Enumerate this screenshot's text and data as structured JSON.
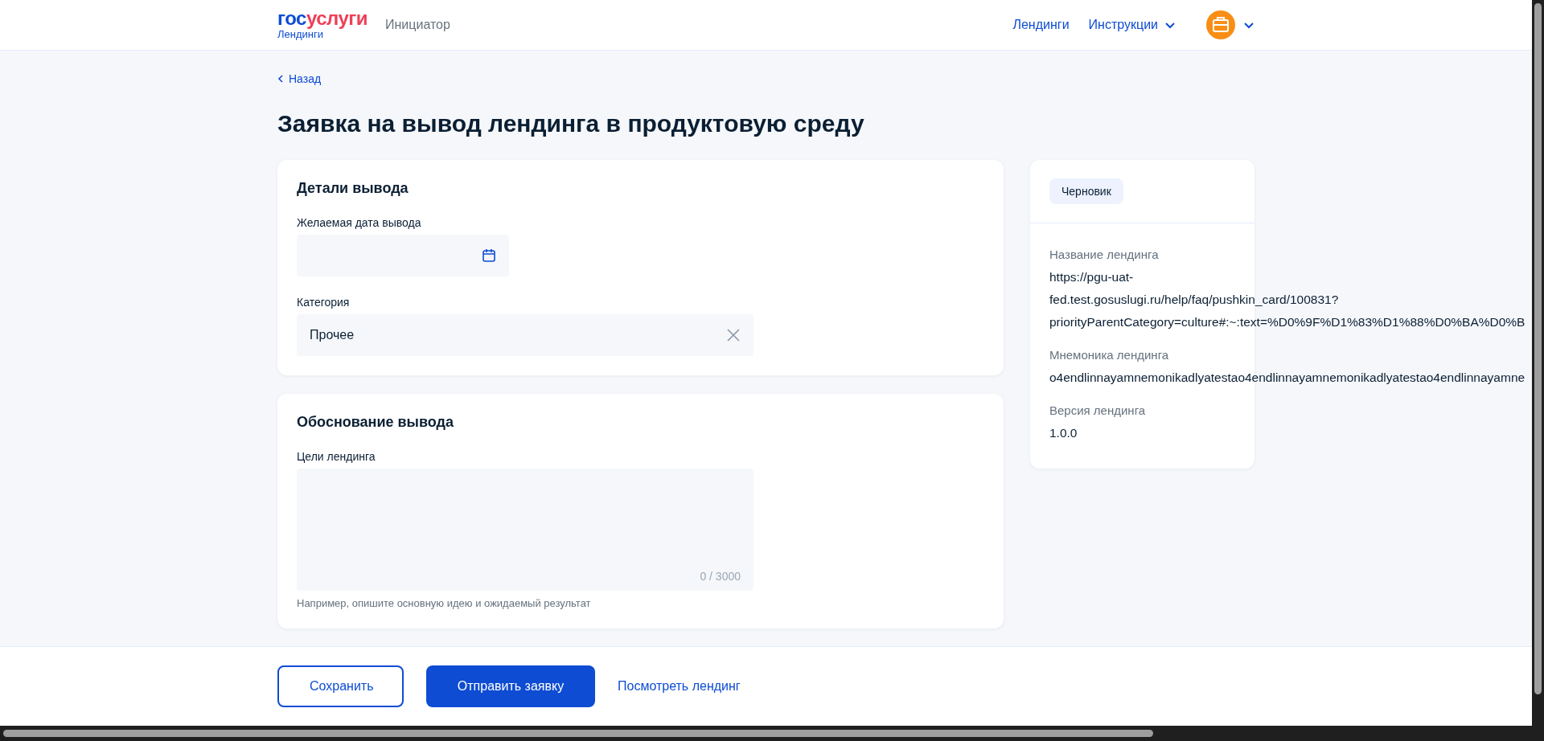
{
  "header": {
    "logo": [
      {
        "text": "гос",
        "color": "#0d4cd3"
      },
      {
        "text": "услуги",
        "color": "#ee3f58"
      }
    ],
    "logo_sub": "Лендинги",
    "role": "Инициатор",
    "nav": [
      {
        "label": "Лендинги",
        "dropdown": false
      },
      {
        "label": "Инструкции",
        "dropdown": true
      }
    ]
  },
  "back_link": "Назад",
  "title": "Заявка на вывод лендинга в продуктовую среду",
  "sections": [
    {
      "title": "Детали вывода",
      "fields": [
        {
          "kind": "date",
          "label": "Желаемая дата вывода"
        },
        {
          "kind": "select",
          "label": "Категория",
          "value": "Прочее"
        }
      ]
    },
    {
      "title": "Обоснование вывода",
      "fields": [
        {
          "kind": "textarea",
          "label": "Цели лендинга",
          "counter": "0 / 3000",
          "hint": "Например, опишите основную идею и ожидаемый результат"
        }
      ]
    }
  ],
  "side": {
    "status": "Черновик",
    "items": [
      {
        "label": "Название лендинга",
        "lines": [
          "https://pgu-uat-",
          "fed.test.gosuslugi.ru/help/faq/pushkin_card/100831?",
          "priorityParentCategory=culture#:~:text=%D0%9F%D1%83%D1%88%D0%BA%D0%B"
        ]
      },
      {
        "label": "Мнемоника лендинга",
        "lines": [
          "o4endlinnayamnemonikadlyatestao4endlinnayamnemonikadlyatestao4endlinnayamne"
        ]
      },
      {
        "label": "Версия лендинга",
        "lines": [
          "1.0.0"
        ]
      }
    ]
  },
  "footer": {
    "buttons": [
      {
        "kind": "outline",
        "label": "Сохранить"
      },
      {
        "kind": "primary",
        "label": "Отправить заявку"
      },
      {
        "kind": "link",
        "label": "Посмотреть лендинг"
      }
    ]
  }
}
